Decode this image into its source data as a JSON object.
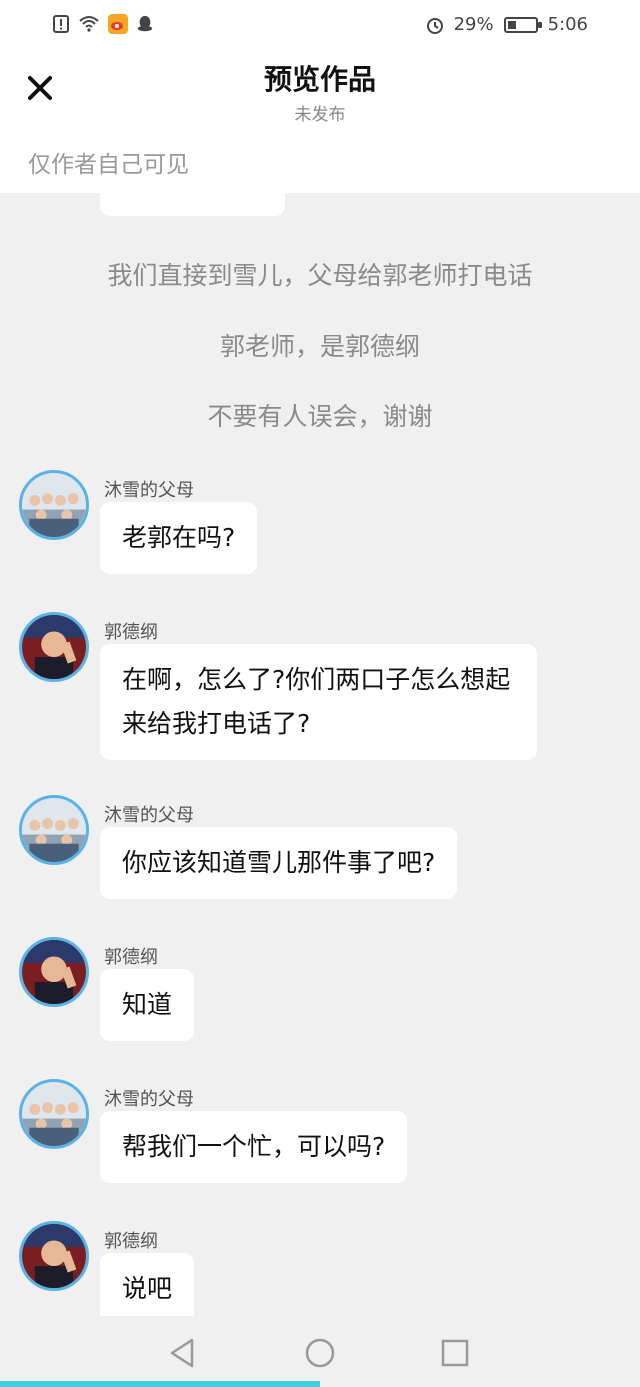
{
  "statusbar": {
    "battery_text": "29%",
    "battery_level": 0.29,
    "time": "5:06",
    "icons": [
      "alert-icon",
      "wifi-icon",
      "weibo-icon",
      "qq-icon",
      "alarm-icon",
      "battery-icon"
    ]
  },
  "header": {
    "title": "预览作品",
    "subtitle": "未发布",
    "visibility_note": "仅作者自己可见"
  },
  "narration": [
    "我们直接到雪儿，父母给郭老师打电话",
    "郭老师，是郭德纲",
    "不要有人误会，谢谢"
  ],
  "messages": [
    {
      "sender": "沐雪的父母",
      "text": "老郭在吗?"
    },
    {
      "sender": "郭德纲",
      "text": "在啊，怎么了?你们两口子怎么想起来给我打电话了?"
    },
    {
      "sender": "沐雪的父母",
      "text": "你应该知道雪儿那件事了吧?"
    },
    {
      "sender": "郭德纲",
      "text": "知道"
    },
    {
      "sender": "沐雪的父母",
      "text": "帮我们一个忙，可以吗?"
    },
    {
      "sender": "郭德纲",
      "text": "说吧"
    }
  ],
  "progress": 0.5,
  "colors": {
    "avatar_ring": "#5ab3e6",
    "progress": "#3ed0e0",
    "background": "#f0f0f0"
  }
}
